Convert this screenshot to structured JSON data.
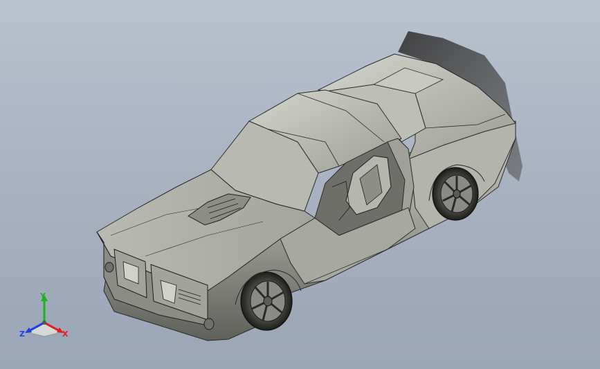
{
  "viewport": {
    "background_top": "#b9c2cf",
    "background_bottom": "#9aa5b6"
  },
  "model": {
    "icon": "car-3d-model",
    "body_color": "#a9aaa2",
    "edge_color": "#2c2c2c",
    "shadow_color": "#4a4a4a"
  },
  "triad": {
    "icon": "coordinate-triad-icon",
    "x_label": "X",
    "y_label": "Y",
    "z_label": "Z",
    "x_color": "#e02020",
    "y_color": "#20b020",
    "z_color": "#2040e0"
  }
}
